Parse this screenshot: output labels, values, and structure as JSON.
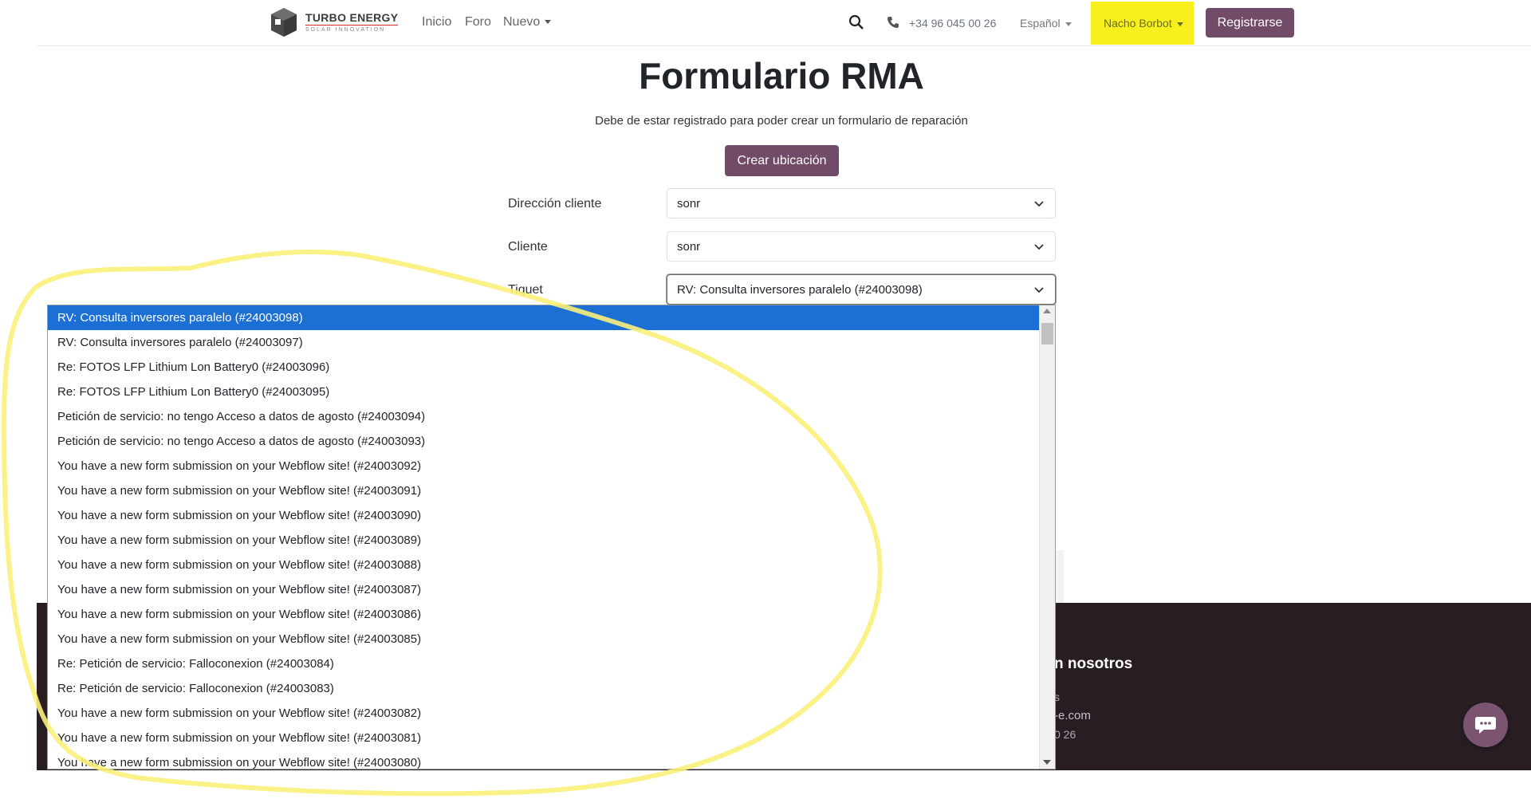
{
  "brand": {
    "name": "TURBO ENERGY",
    "tagline": "SOLAR INNOVATION"
  },
  "nav": {
    "home": "Inicio",
    "forum": "Foro",
    "new": "Nuevo"
  },
  "header": {
    "phone": "+34 96 045 00 26",
    "language": "Español",
    "user": "Nacho Borbot",
    "register": "Registrarse"
  },
  "page": {
    "title": "Formulario RMA",
    "subtitle": "Debe de estar registrado para poder crear un formulario de reparación",
    "create_button": "Crear ubicación"
  },
  "form": {
    "direccion_label": "Dirección cliente",
    "direccion_value": "sonr",
    "cliente_label": "Cliente",
    "cliente_value": "sonr",
    "tiquet_label": "Tiquet",
    "tiquet_value": "RV: Consulta inversores paralelo (#24003098)"
  },
  "dropdown": {
    "options": [
      "RV: Consulta inversores paralelo (#24003098)",
      "RV: Consulta inversores paralelo (#24003097)",
      "Re: FOTOS LFP Lithium Lon Battery0 (#24003096)",
      "Re: FOTOS LFP Lithium Lon Battery0 (#24003095)",
      "Petición de servicio: no tengo Acceso a datos de agosto (#24003094)",
      "Petición de servicio: no tengo Acceso a datos de agosto (#24003093)",
      "You have a new form submission on your Webflow site! (#24003092)",
      "You have a new form submission on your Webflow site! (#24003091)",
      "You have a new form submission on your Webflow site! (#24003090)",
      "You have a new form submission on your Webflow site! (#24003089)",
      "You have a new form submission on your Webflow site! (#24003088)",
      "You have a new form submission on your Webflow site! (#24003087)",
      "You have a new form submission on your Webflow site! (#24003086)",
      "You have a new form submission on your Webflow site! (#24003085)",
      "Re: Petición de servicio: Falloconexion (#24003084)",
      "Re: Petición de servicio: Falloconexion (#24003083)",
      "You have a new form submission on your Webflow site! (#24003082)",
      "You have a new form submission on your Webflow site! (#24003081)",
      "You have a new form submission on your Webflow site! (#24003080)"
    ]
  },
  "footer": {
    "heading": "n nosotros",
    "line1": "s",
    "line2": "-e.com",
    "line3": "0 26"
  },
  "colors": {
    "brand": "#714b67",
    "highlight": "#f7f01c",
    "selected": "#1b6fd5",
    "footer": "#271d23"
  },
  "icons": [
    "search-icon",
    "phone-icon",
    "chevron-down-icon",
    "chat-icon",
    "logo-cube-icon"
  ]
}
